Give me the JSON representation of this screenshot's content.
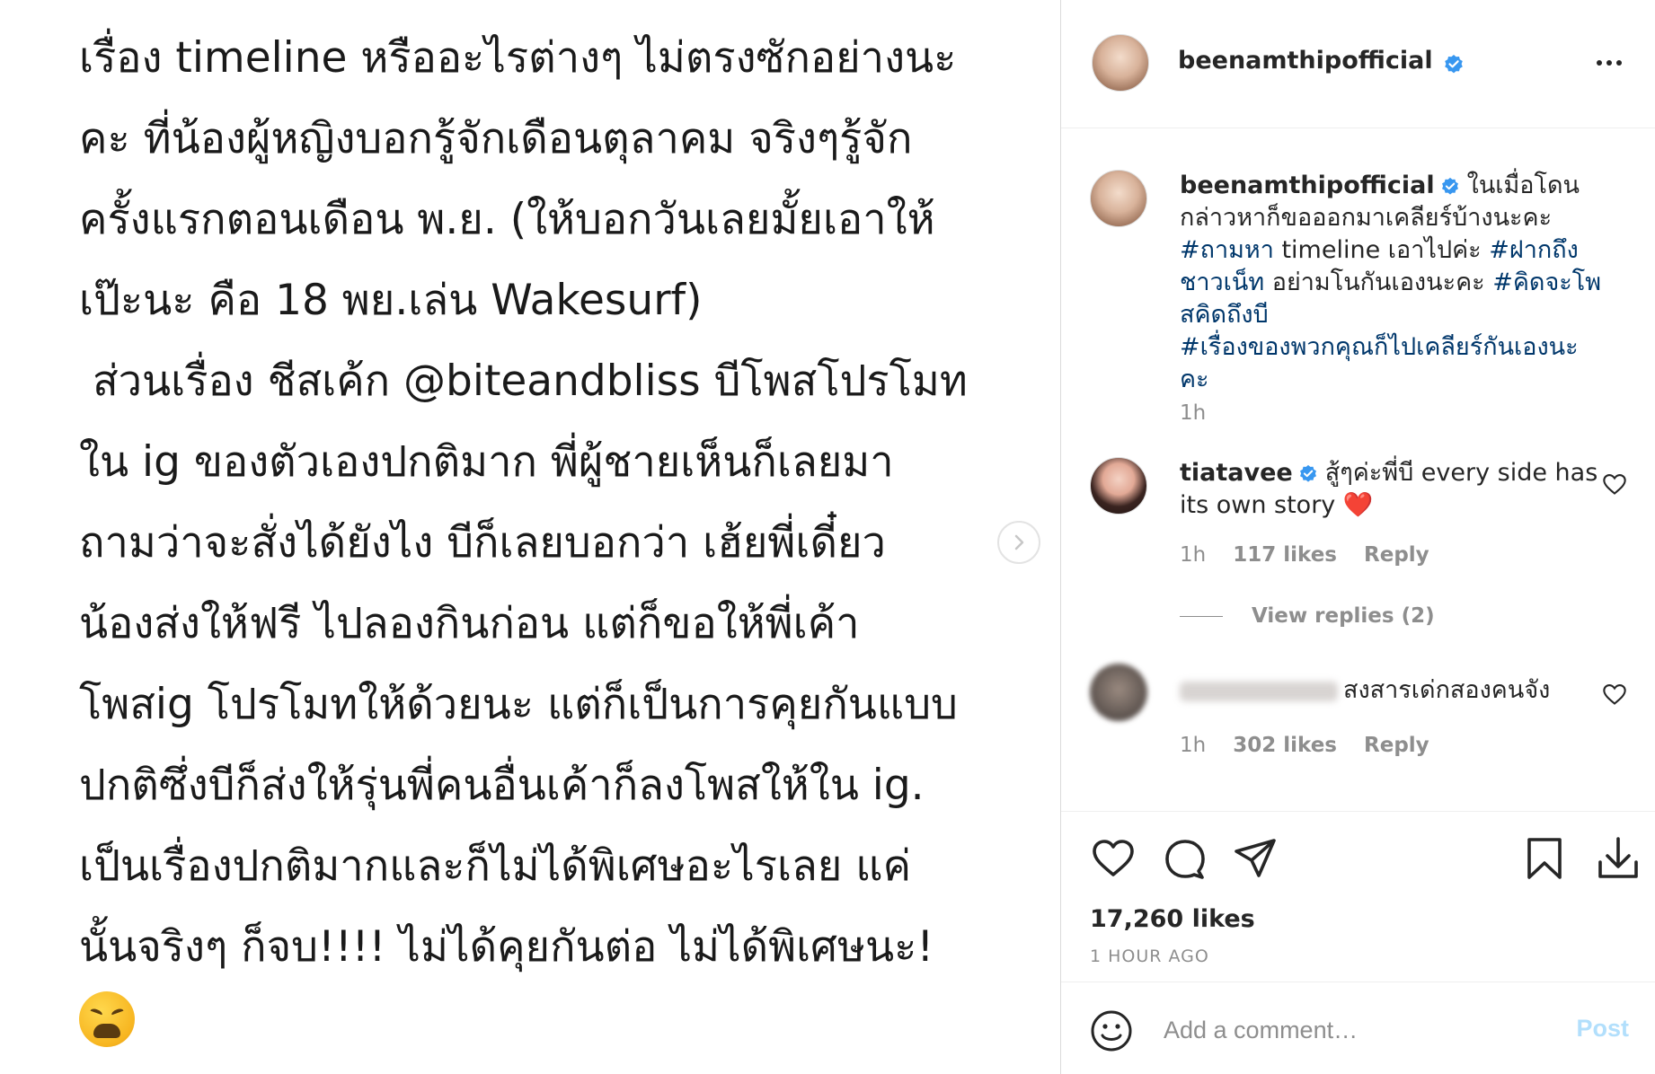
{
  "post_image": {
    "lines": [
      "เรื่อง timeline หรืออะไรต่างๆ ไม่ตรงซักอย่างนะ",
      "คะ ที่น้องผู้หญิงบอกรู้จักเดือนตุลาคม จริงๆรู้จัก",
      "ครั้งแรกตอนเดือน พ.ย. (ให้บอกวันเลยมั้ยเอาให้",
      "เป๊ะนะ คือ 18 พย.เล่น Wakesurf)",
      " ส่วนเรื่อง ชีสเค้ก @biteandbliss บีโพสโปรโมท",
      "ใน ig ของตัวเองปกติมาก พี่ผู้ชายเห็นก็เลยมา",
      "ถามว่าจะสั่งได้ยังไง บีก็เลยบอกว่า เฮ้ยพี่เดี๋ยว",
      "น้องส่งให้ฟรี ไปลองกินก่อน แต่ก็ขอให้พี่เค้า",
      "โพสig โปรโมทให้ด้วยนะ แต่ก็เป็นการคุยกันแบบ",
      "ปกติซึ่งบีก็ส่งให้รุ่นพี่คนอื่นเค้าก็ลงโพสให้ใน ig.",
      "เป็นเรื่องปกติมากและก็ไม่ได้พิเศษอะไรเลย แค่",
      "นั้นจริงๆ ก็จบ!!!! ไม่ได้คุยกันต่อ ไม่ได้พิเศษนะ!"
    ],
    "emoji": "weary-face-emoji"
  },
  "header": {
    "username": "beenamthipofficial",
    "verified": true
  },
  "caption": {
    "username": "beenamthipofficial",
    "text_1": "ในเมื่อโดนกล่าวหาก็ขอออกมาเคลียร์บ้างนะคะ",
    "hashtag_1": "#ถามหา",
    "text_2": " timeline เอาไปค่ะ ",
    "hashtag_2": "#ฝากถึงชาวเน็ท",
    "text_3": " อย่ามโนกันเองนะคะ ",
    "hashtag_3": "#คิดจะโพสคิดถึงบี",
    "hashtag_4": "#เรื่องของพวกคุณก็ไปเคลียร์กันเองนะคะ",
    "time": "1h"
  },
  "comments": [
    {
      "username": "tiatavee",
      "verified": true,
      "text": "สู้ๆค่ะพี่บี every side has its own story",
      "emoji": "❤️",
      "time": "1h",
      "likes": "117 likes",
      "reply": "Reply",
      "view_replies": "View replies (2)"
    },
    {
      "username_blurred": true,
      "text": "สงสารเด่กสองคนจัง",
      "time": "1h",
      "likes": "302 likes",
      "reply": "Reply"
    }
  ],
  "actions": {
    "likes": "17,260 likes",
    "time_ago": "1 HOUR AGO"
  },
  "comment_box": {
    "placeholder": "Add a comment…",
    "post_label": "Post"
  },
  "colors": {
    "verified_blue": "#3897f0",
    "hashtag": "#00376b",
    "secondary_text": "#8e8e8e",
    "post_disabled": "#b2dffc",
    "heart_red": "#ed4956"
  }
}
